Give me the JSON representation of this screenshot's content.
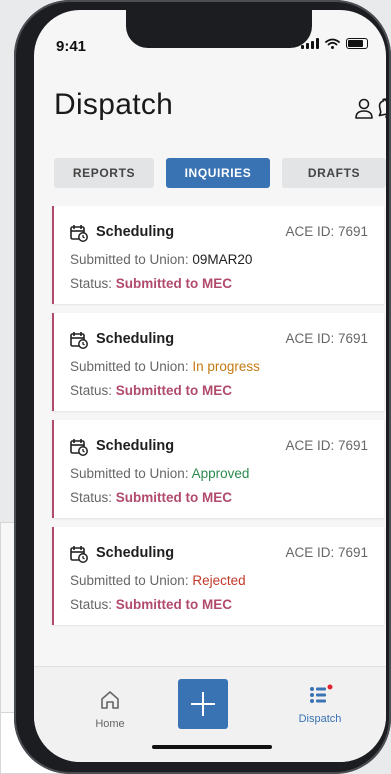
{
  "status_bar": {
    "time": "9:41"
  },
  "header": {
    "title": "Dispatch"
  },
  "tabs": [
    {
      "label": "REPORTS",
      "active": false
    },
    {
      "label": "INQUIRIES",
      "active": true
    },
    {
      "label": "DRAFTS",
      "active": false
    }
  ],
  "cards": [
    {
      "title": "Scheduling",
      "ace_id": "ACE ID: 7691",
      "submitted_label": "Submitted to Union: ",
      "submitted_value": "09MAR20",
      "status_label": "Status: ",
      "status_value": "Submitted to MEC"
    },
    {
      "title": "Scheduling",
      "ace_id": "ACE ID: 7691",
      "submitted_label": "Submitted to Union: ",
      "submitted_value": "In progress",
      "status_label": "Status: ",
      "status_value": "Submitted to MEC"
    },
    {
      "title": "Scheduling",
      "ace_id": "ACE ID: 7691",
      "submitted_label": "Submitted to Union: ",
      "submitted_value": "Approved",
      "status_label": "Status: ",
      "status_value": "Submitted to MEC"
    },
    {
      "title": "Scheduling",
      "ace_id": "ACE ID: 7691",
      "submitted_label": "Submitted to Union: ",
      "submitted_value": "Rejected",
      "status_label": "Status: ",
      "status_value": "Submitted to MEC"
    }
  ],
  "bottom_nav": {
    "home_label": "Home",
    "dispatch_label": "Dispatch"
  },
  "colors": {
    "accent": "#3a73b4",
    "card_border": "#b14b6c",
    "in_progress": "#c47a10",
    "approved": "#2c8a4f",
    "rejected": "#c0392b",
    "notification_dot": "#e0242f"
  },
  "icons": {
    "user": "user-icon",
    "bell": "bell-icon",
    "calendar": "calendar-clock-icon",
    "home": "home-icon",
    "plus": "plus-icon",
    "list": "list-icon"
  }
}
